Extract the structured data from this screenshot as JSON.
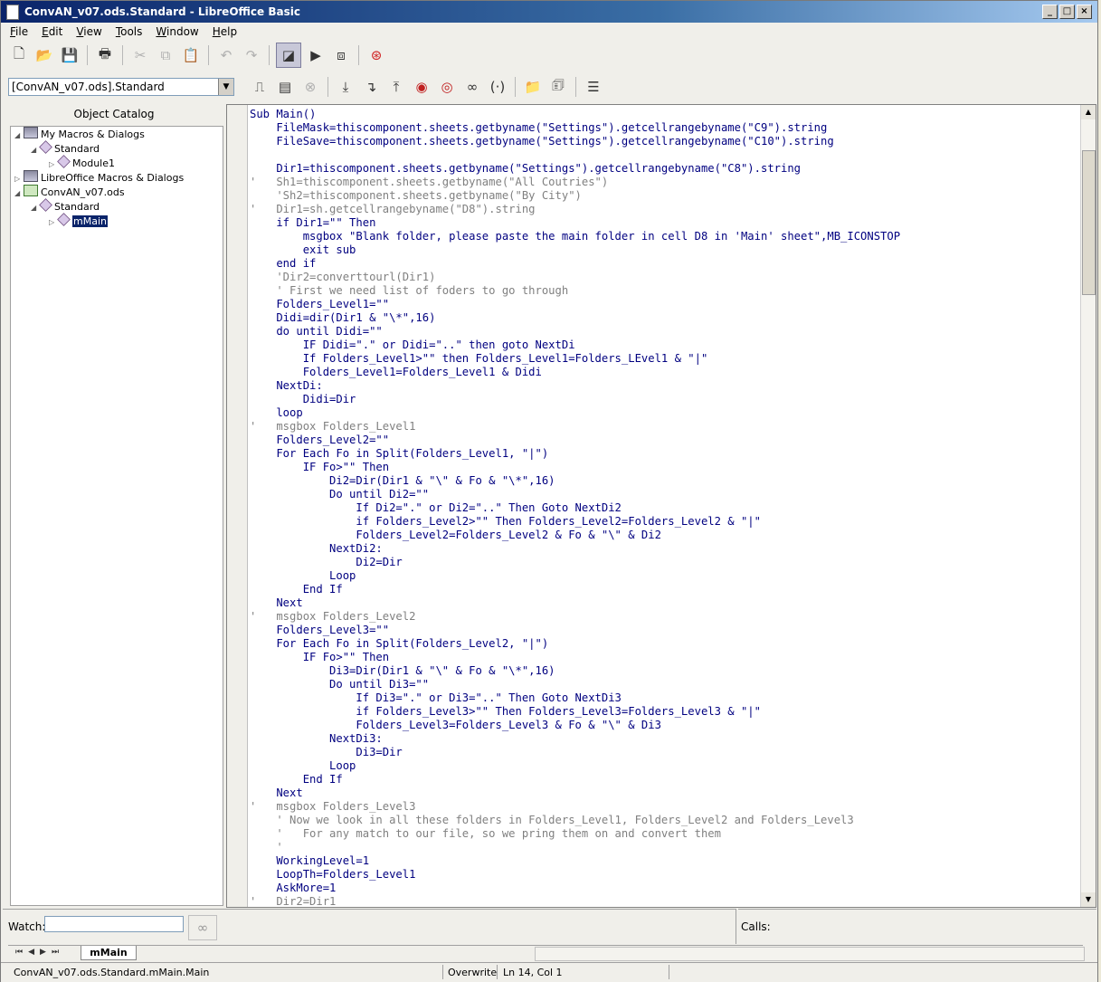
{
  "window": {
    "title": "ConvAN_v07.ods.Standard - LibreOffice Basic",
    "controls": [
      "_",
      "□",
      "×"
    ]
  },
  "menu": [
    "File",
    "Edit",
    "View",
    "Tools",
    "Window",
    "Help"
  ],
  "library_select": {
    "value": "[ConvAN_v07.ods].Standard"
  },
  "catalog": {
    "title": "Object Catalog",
    "nodes": {
      "my_macros": "My Macros & Dialogs",
      "standard1": "Standard",
      "module1": "Module1",
      "lo_macros": "LibreOffice Macros & Dialogs",
      "doc": "ConvAN_v07.ods",
      "standard2": "Standard",
      "mmain": "mMain"
    }
  },
  "code_lines": [
    {
      "t": "Sub Main()"
    },
    {
      "t": "    FileMask=thiscomponent.sheets.getbyname(\"Settings\").getcellrangebyname(\"C9\").string"
    },
    {
      "t": "    FileSave=thiscomponent.sheets.getbyname(\"Settings\").getcellrangebyname(\"C10\").string"
    },
    {
      "t": ""
    },
    {
      "t": "    Dir1=thiscomponent.sheets.getbyname(\"Settings\").getcellrangebyname(\"C8\").string"
    },
    {
      "t": "'   Sh1=thiscomponent.sheets.getbyname(\"All Coutries\")",
      "c": true
    },
    {
      "t": "    'Sh2=thiscomponent.sheets.getbyname(\"By City\")",
      "c": true
    },
    {
      "t": "'   Dir1=sh.getcellrangebyname(\"D8\").string",
      "c": true
    },
    {
      "t": "    if Dir1=\"\" Then"
    },
    {
      "t": "        msgbox \"Blank folder, please paste the main folder in cell D8 in 'Main' sheet\",MB_ICONSTOP"
    },
    {
      "t": "        exit sub"
    },
    {
      "t": "    end if"
    },
    {
      "t": "    'Dir2=converttourl(Dir1)",
      "c": true
    },
    {
      "t": "    ' First we need list of foders to go through",
      "c": true
    },
    {
      "t": "    Folders_Level1=\"\""
    },
    {
      "t": "    Didi=dir(Dir1 & \"\\*\",16)"
    },
    {
      "t": "    do until Didi=\"\""
    },
    {
      "t": "        IF Didi=\".\" or Didi=\"..\" then goto NextDi"
    },
    {
      "t": "        If Folders_Level1>\"\" then Folders_Level1=Folders_LEvel1 & \"|\""
    },
    {
      "t": "        Folders_Level1=Folders_Level1 & Didi"
    },
    {
      "t": "    NextDi:"
    },
    {
      "t": "        Didi=Dir"
    },
    {
      "t": "    loop"
    },
    {
      "t": "'   msgbox Folders_Level1",
      "c": true
    },
    {
      "t": "    Folders_Level2=\"\""
    },
    {
      "t": "    For Each Fo in Split(Folders_Level1, \"|\")"
    },
    {
      "t": "        IF Fo>\"\" Then"
    },
    {
      "t": "            Di2=Dir(Dir1 & \"\\\" & Fo & \"\\*\",16)"
    },
    {
      "t": "            Do until Di2=\"\""
    },
    {
      "t": "                If Di2=\".\" or Di2=\"..\" Then Goto NextDi2"
    },
    {
      "t": "                if Folders_Level2>\"\" Then Folders_Level2=Folders_Level2 & \"|\""
    },
    {
      "t": "                Folders_Level2=Folders_Level2 & Fo & \"\\\" & Di2"
    },
    {
      "t": "            NextDi2:"
    },
    {
      "t": "                Di2=Dir"
    },
    {
      "t": "            Loop"
    },
    {
      "t": "        End If"
    },
    {
      "t": "    Next"
    },
    {
      "t": "'   msgbox Folders_Level2",
      "c": true
    },
    {
      "t": "    Folders_Level3=\"\""
    },
    {
      "t": "    For Each Fo in Split(Folders_Level2, \"|\")"
    },
    {
      "t": "        IF Fo>\"\" Then"
    },
    {
      "t": "            Di3=Dir(Dir1 & \"\\\" & Fo & \"\\*\",16)"
    },
    {
      "t": "            Do until Di3=\"\""
    },
    {
      "t": "                If Di3=\".\" or Di3=\"..\" Then Goto NextDi3"
    },
    {
      "t": "                if Folders_Level3>\"\" Then Folders_Level3=Folders_Level3 & \"|\""
    },
    {
      "t": "                Folders_Level3=Folders_Level3 & Fo & \"\\\" & Di3"
    },
    {
      "t": "            NextDi3:"
    },
    {
      "t": "                Di3=Dir"
    },
    {
      "t": "            Loop"
    },
    {
      "t": "        End If"
    },
    {
      "t": "    Next"
    },
    {
      "t": "'   msgbox Folders_Level3",
      "c": true
    },
    {
      "t": "    ' Now we look in all these folders in Folders_Level1, Folders_Level2 and Folders_Level3",
      "c": true
    },
    {
      "t": "    '   For any match to our file, so we pring them on and convert them",
      "c": true
    },
    {
      "t": "    '",
      "c": true
    },
    {
      "t": "    WorkingLevel=1"
    },
    {
      "t": "    LoopTh=Folders_Level1"
    },
    {
      "t": "    AskMore=1"
    },
    {
      "t": "'   Dir2=Dir1",
      "c": true
    }
  ],
  "watch": {
    "label": "Watch:"
  },
  "calls": {
    "label": "Calls:"
  },
  "tabs": {
    "active": "mMain"
  },
  "status": {
    "location": "ConvAN_v07.ods.Standard.mMain.Main",
    "mode": "Overwrite",
    "position": "Ln 14, Col 1"
  }
}
